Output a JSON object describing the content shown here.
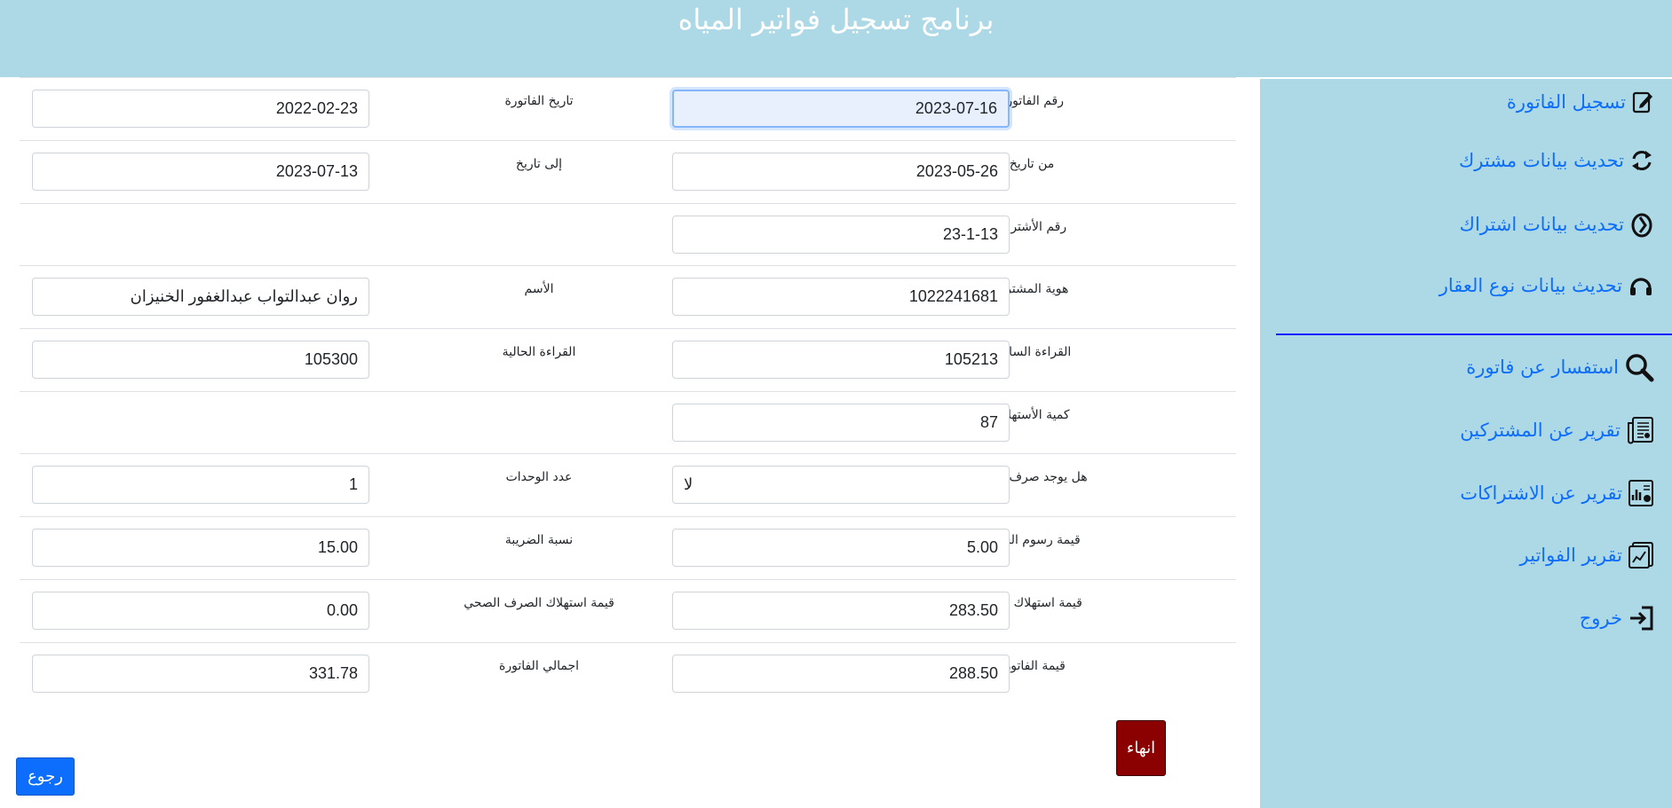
{
  "header": {
    "title": "برنامج تسجيل فواتير المياه"
  },
  "sidebar": {
    "items": [
      {
        "label": "تسجيل الفاتورة",
        "icon": "edit-icon"
      },
      {
        "label": "تحديث بيانات مشترك",
        "icon": "refresh-icon"
      },
      {
        "label": "تحديث بيانات اشتراك",
        "icon": "circular-arrow-icon"
      },
      {
        "label": "تحديث بيانات نوع العقار",
        "icon": "headset-icon"
      },
      {
        "label": "استفسار عن فاتورة",
        "icon": "search-icon"
      },
      {
        "label": "تقرير عن المشتركين",
        "icon": "newspaper-icon"
      },
      {
        "label": "تقرير عن الاشتراكات",
        "icon": "report-chart-icon"
      },
      {
        "label": "تقرير الفواتير",
        "icon": "report-graph-icon"
      },
      {
        "label": "خروج",
        "icon": "exit-icon"
      }
    ],
    "link_color": "#0d6efd",
    "background": "#add8e6"
  },
  "form": {
    "invoice_number": {
      "label": "رقم الفاتورة",
      "value": "2023-07-16"
    },
    "invoice_date": {
      "label": "تاريخ الفاتورة",
      "value": "2022-02-23"
    },
    "from_date": {
      "label": "من تاريخ",
      "value": "2023-05-26"
    },
    "to_date": {
      "label": "إلى تاريخ",
      "value": "2023-07-13"
    },
    "subscription_number": {
      "label": "رقم الأشتراك",
      "value": "23-1-13"
    },
    "subscriber_id": {
      "label": "هوية المشترك",
      "value": "1022241681"
    },
    "name": {
      "label": "الأسم",
      "value": "روان عبدالتواب عبدالغفور الخنيزان"
    },
    "previous_reading": {
      "label": "القراءة السابقة",
      "value": "105213"
    },
    "current_reading": {
      "label": "القراءة الحالية",
      "value": "105300"
    },
    "consumption_amount": {
      "label": "كمية الأستهلاك",
      "value": "87"
    },
    "sewage": {
      "label": "هل يوجد صرف صحي",
      "value": "لا"
    },
    "units_count": {
      "label": "عدد الوحدات",
      "value": "1"
    },
    "service_fee": {
      "label": "قيمة رسوم الخدمة",
      "value": "5.00"
    },
    "tax_rate": {
      "label": "نسبة الضريبة",
      "value": "15.00"
    },
    "water_consumption_value": {
      "label": "قيمة استهلاك المياه",
      "value": "283.50"
    },
    "sewage_consumption_value": {
      "label": "قيمة استهلاك الصرف الصحي",
      "value": "0.00"
    },
    "invoice_value": {
      "label": "قيمة الفاتورة",
      "value": "288.50"
    },
    "invoice_total": {
      "label": "اجمالي الفاتورة",
      "value": "331.78"
    }
  },
  "buttons": {
    "finish_label": "انهاء",
    "back_label": "رجوع"
  },
  "colors": {
    "header": "#add8e6",
    "finish": "#8b0000",
    "back": "#0d6efd"
  }
}
